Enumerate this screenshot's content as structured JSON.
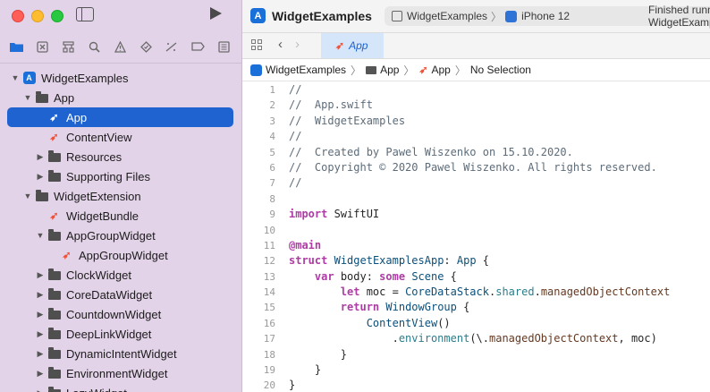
{
  "sidebar": {
    "tree": [
      {
        "label": "WidgetExamples",
        "indent": 0,
        "icon": "project-icon",
        "chevron": "expanded"
      },
      {
        "label": "App",
        "indent": 1,
        "icon": "folder-icon",
        "chevron": "expanded"
      },
      {
        "label": "App",
        "indent": 2,
        "icon": "swift-file-icon",
        "chevron": "",
        "selected": true
      },
      {
        "label": "ContentView",
        "indent": 2,
        "icon": "swift-file-icon",
        "chevron": ""
      },
      {
        "label": "Resources",
        "indent": 2,
        "icon": "folder-icon",
        "chevron": "collapsed"
      },
      {
        "label": "Supporting Files",
        "indent": 2,
        "icon": "folder-icon",
        "chevron": "collapsed"
      },
      {
        "label": "WidgetExtension",
        "indent": 1,
        "icon": "folder-icon",
        "chevron": "expanded"
      },
      {
        "label": "WidgetBundle",
        "indent": 2,
        "icon": "swift-file-icon",
        "chevron": ""
      },
      {
        "label": "AppGroupWidget",
        "indent": 2,
        "icon": "folder-icon",
        "chevron": "expanded"
      },
      {
        "label": "AppGroupWidget",
        "indent": 3,
        "icon": "swift-file-icon",
        "chevron": ""
      },
      {
        "label": "ClockWidget",
        "indent": 2,
        "icon": "folder-icon",
        "chevron": "collapsed"
      },
      {
        "label": "CoreDataWidget",
        "indent": 2,
        "icon": "folder-icon",
        "chevron": "collapsed"
      },
      {
        "label": "CountdownWidget",
        "indent": 2,
        "icon": "folder-icon",
        "chevron": "collapsed"
      },
      {
        "label": "DeepLinkWidget",
        "indent": 2,
        "icon": "folder-icon",
        "chevron": "collapsed"
      },
      {
        "label": "DynamicIntentWidget",
        "indent": 2,
        "icon": "folder-icon",
        "chevron": "collapsed"
      },
      {
        "label": "EnvironmentWidget",
        "indent": 2,
        "icon": "folder-icon",
        "chevron": "collapsed"
      },
      {
        "label": "LazyWidget",
        "indent": 2,
        "icon": "folder-icon",
        "chevron": "collapsed"
      }
    ]
  },
  "titlebar": {
    "title": "WidgetExamples",
    "scheme": "WidgetExamples",
    "device": "iPhone 12",
    "status": "Finished running WidgetExamples"
  },
  "tabbar": {
    "active_tab": "App"
  },
  "jumpbar": {
    "project": "WidgetExamples",
    "folder": "App",
    "file": "App",
    "selection": "No Selection"
  },
  "code": {
    "lines": [
      [
        {
          "text": "//",
          "cls": "c"
        }
      ],
      [
        {
          "text": "//  App.swift",
          "cls": "c"
        }
      ],
      [
        {
          "text": "//  WidgetExamples",
          "cls": "c"
        }
      ],
      [
        {
          "text": "//",
          "cls": "c"
        }
      ],
      [
        {
          "text": "//  Created by Pawel Wiszenko on 15.10.2020.",
          "cls": "c"
        }
      ],
      [
        {
          "text": "//  Copyright © 2020 Pawel Wiszenko. All rights reserved.",
          "cls": "c"
        }
      ],
      [
        {
          "text": "//",
          "cls": "c"
        }
      ],
      [],
      [
        {
          "text": "import",
          "cls": "k"
        },
        {
          "text": " SwiftUI",
          "cls": ""
        }
      ],
      [],
      [
        {
          "text": "@main",
          "cls": "k"
        }
      ],
      [
        {
          "text": "struct",
          "cls": "k"
        },
        {
          "text": " ",
          "cls": ""
        },
        {
          "text": "WidgetExamplesApp",
          "cls": "t"
        },
        {
          "text": ": ",
          "cls": ""
        },
        {
          "text": "App",
          "cls": "t"
        },
        {
          "text": " {",
          "cls": ""
        }
      ],
      [
        {
          "text": "    ",
          "cls": ""
        },
        {
          "text": "var",
          "cls": "k"
        },
        {
          "text": " body: ",
          "cls": ""
        },
        {
          "text": "some",
          "cls": "k"
        },
        {
          "text": " ",
          "cls": ""
        },
        {
          "text": "Scene",
          "cls": "t"
        },
        {
          "text": " {",
          "cls": ""
        }
      ],
      [
        {
          "text": "        ",
          "cls": ""
        },
        {
          "text": "let",
          "cls": "k"
        },
        {
          "text": " moc = ",
          "cls": ""
        },
        {
          "text": "CoreDataStack",
          "cls": "t"
        },
        {
          "text": ".",
          "cls": ""
        },
        {
          "text": "shared",
          "cls": "f"
        },
        {
          "text": ".",
          "cls": ""
        },
        {
          "text": "managedObjectContext",
          "cls": "a"
        }
      ],
      [
        {
          "text": "        ",
          "cls": ""
        },
        {
          "text": "return",
          "cls": "k"
        },
        {
          "text": " ",
          "cls": ""
        },
        {
          "text": "WindowGroup",
          "cls": "t"
        },
        {
          "text": " {",
          "cls": ""
        }
      ],
      [
        {
          "text": "            ",
          "cls": ""
        },
        {
          "text": "ContentView",
          "cls": "t"
        },
        {
          "text": "()",
          "cls": ""
        }
      ],
      [
        {
          "text": "                .",
          "cls": ""
        },
        {
          "text": "environment",
          "cls": "f"
        },
        {
          "text": "(\\.",
          "cls": ""
        },
        {
          "text": "managedObjectContext",
          "cls": "a"
        },
        {
          "text": ", moc)",
          "cls": ""
        }
      ],
      [
        {
          "text": "        }",
          "cls": ""
        }
      ],
      [
        {
          "text": "    }",
          "cls": ""
        }
      ],
      [
        {
          "text": "}",
          "cls": ""
        }
      ]
    ]
  }
}
